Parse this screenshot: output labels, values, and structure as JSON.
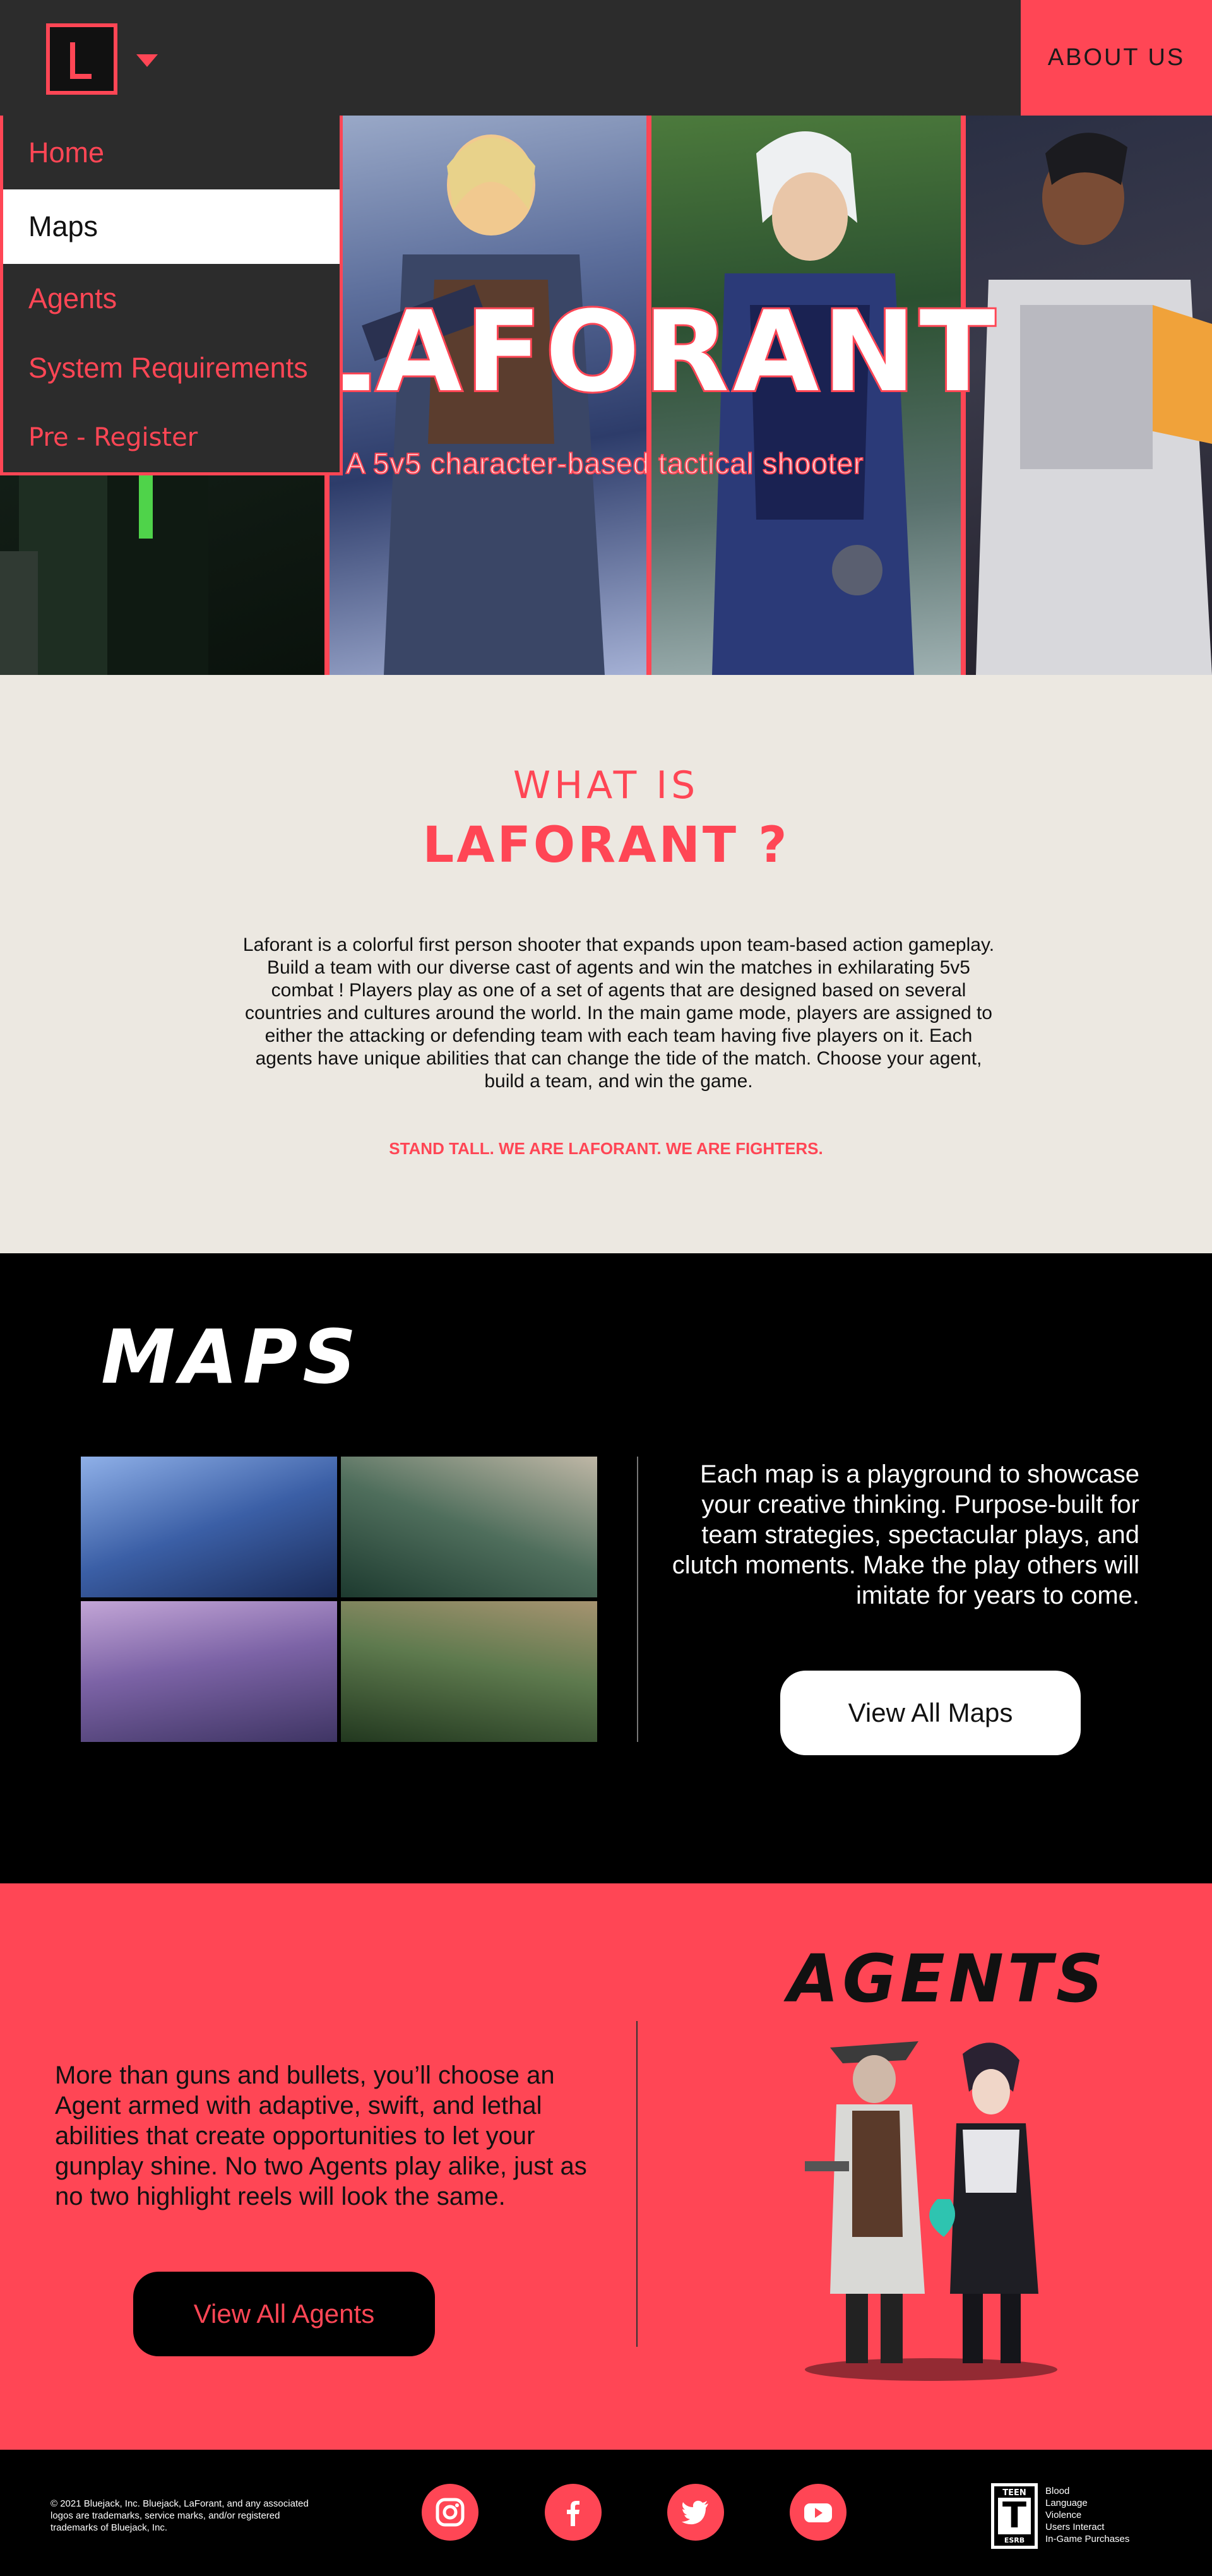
{
  "header": {
    "about_label": "ABOUT US"
  },
  "menu": {
    "items": [
      {
        "label": "Home"
      },
      {
        "label": "Maps"
      },
      {
        "label": "Agents"
      },
      {
        "label": "System Requirements"
      },
      {
        "label": "Pre - Register"
      }
    ],
    "active_index": 1
  },
  "hero": {
    "title": "LAFORANT",
    "subtitle": "A 5v5 character-based tactical shooter"
  },
  "whatis": {
    "line1": "WHAT IS",
    "line2": "LAFORANT ?",
    "body": "Laforant is a colorful first person shooter that expands upon team-based action gameplay. Build a team with our diverse cast of agents and win the matches in exhilarating 5v5 combat ! Players play as one of a set of agents that are designed based on several countries and cultures around the world. In the main game mode, players are assigned to either the attacking or defending team with each team having five players on it. Each agents have unique abilities that can change the tide of the match. Choose your agent, build a team, and win the game.",
    "tagline": "STAND TALL. WE ARE LAFORANT. WE ARE FIGHTERS."
  },
  "maps": {
    "title": "MAPS",
    "description": "Each map is a playground to showcase your creative thinking. Purpose-built for team strategies, spectacular plays, and clutch moments. Make the play others will imitate for years to come.",
    "button": "View All Maps"
  },
  "agents": {
    "title": "AGENTS",
    "description": "More than guns and bullets, you’ll choose an Agent armed with adaptive, swift, and lethal abilities that create opportunities to let your gunplay shine. No two Agents play alike, just as no two highlight reels will look the same.",
    "button": "View All Agents"
  },
  "footer": {
    "copyright": "© 2021 Bluejack, Inc. Bluejack, LaForant, and any associated logos are trademarks, service marks, and/or registered trademarks of Bluejack, Inc.",
    "social": [
      "instagram-icon",
      "facebook-icon",
      "twitter-icon",
      "youtube-icon"
    ],
    "esrb": {
      "top": "TEEN",
      "letter": "T",
      "bottom": "ESRB",
      "descriptors": [
        "Blood",
        "Language",
        "Violence",
        "Users Interact",
        "In-Game Purchases"
      ]
    }
  },
  "colors": {
    "accent": "#ff4655",
    "header_bg": "#2c2c2c",
    "cream": "#ece8e1",
    "black": "#000000",
    "white": "#ffffff"
  }
}
